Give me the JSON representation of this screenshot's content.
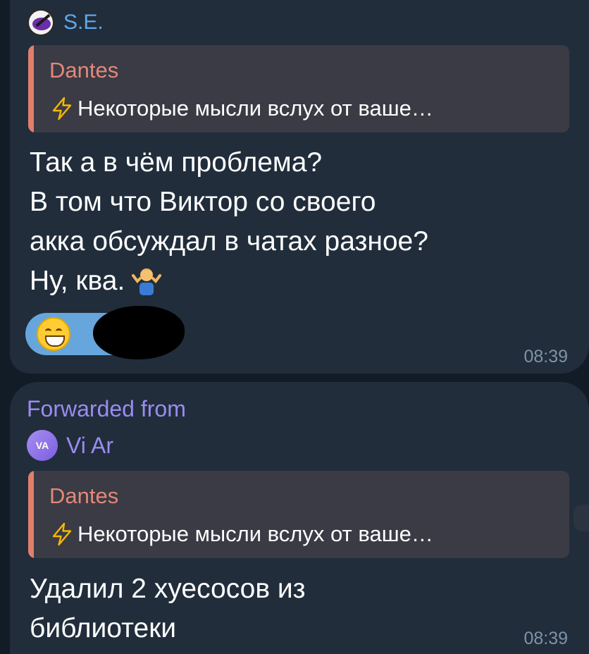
{
  "messages": [
    {
      "sender": "S.E.",
      "quote": {
        "author": "Dantes",
        "text": "Некоторые мысли вслух от ваше…"
      },
      "lines": [
        "Так а в чём проблема?",
        "В том что Виктор со своего",
        "акка обсуждал в чатах разное?",
        "Ну, ква."
      ],
      "reaction_icon": "grinning-face-icon",
      "time": "08:39"
    },
    {
      "forwarded_label": "Forwarded from",
      "forwarded_avatar": "VA",
      "forwarded_name": "Vi Ar",
      "quote": {
        "author": "Dantes",
        "text": "Некоторые мысли вслух от ваше…"
      },
      "lines": [
        "Удалил 2 хуесосов из",
        "библиотеки"
      ],
      "time": "08:39"
    }
  ],
  "colors": {
    "bubble": "#212d3b",
    "sender_name": "#5fa8e8",
    "quote_author": "#e4877a",
    "quote_bar": "#e07f6b",
    "forwarded": "#9a8cf0",
    "reaction_pill": "#66a6dc",
    "timestamp": "#7f93a6"
  }
}
